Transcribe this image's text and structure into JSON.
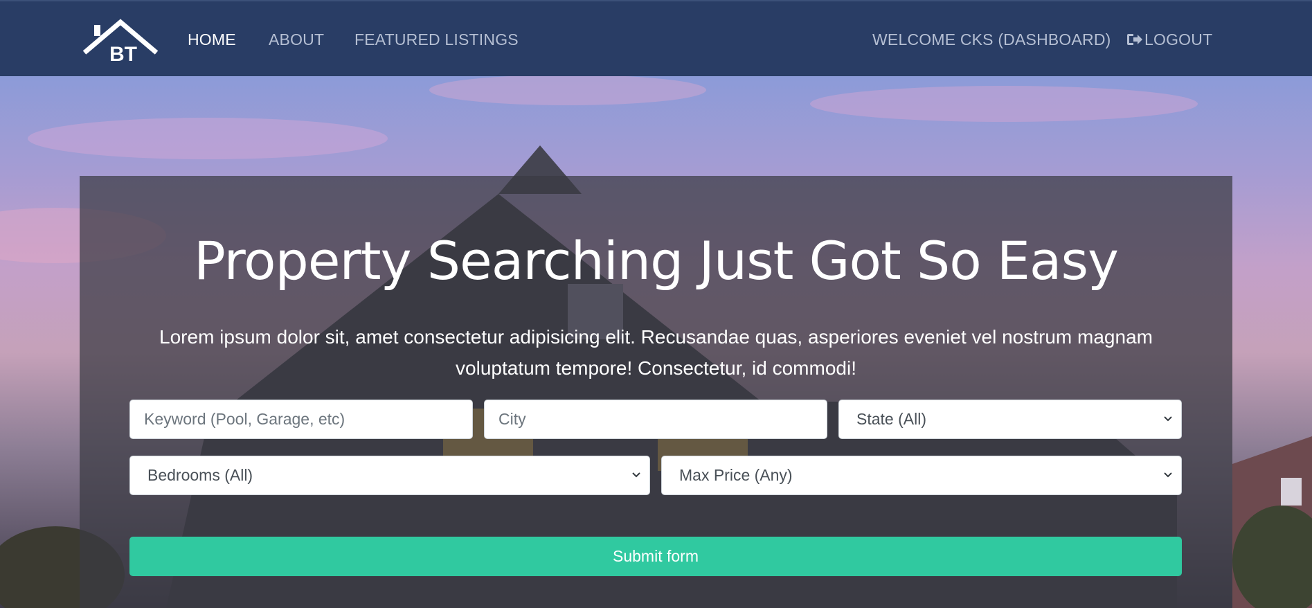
{
  "navbar": {
    "logo_text": "BT",
    "links": [
      {
        "label": "HOME",
        "active": true
      },
      {
        "label": "ABOUT",
        "active": false
      },
      {
        "label": "FEATURED LISTINGS",
        "active": false
      }
    ],
    "welcome": "WELCOME CKS (DASHBOARD)",
    "logout": "LOGOUT",
    "logout_icon": "sign-out-icon"
  },
  "hero": {
    "headline": "Property Searching Just Got So Easy",
    "lead": "Lorem ipsum dolor sit, amet consectetur adipisicing elit. Recusandae quas, asperiores eveniet vel nostrum magnam voluptatum tempore! Consectetur, id commodi!"
  },
  "search_form": {
    "keyword_placeholder": "Keyword (Pool, Garage, etc)",
    "city_placeholder": "City",
    "state_selected": "State (All)",
    "bedrooms_selected": "Bedrooms (All)",
    "price_selected": "Max Price (Any)",
    "submit_label": "Submit form"
  },
  "colors": {
    "navbar_bg": "#293d65",
    "submit_bg": "#30c9a0",
    "panel_overlay": "rgba(58,58,66,0.72)"
  }
}
